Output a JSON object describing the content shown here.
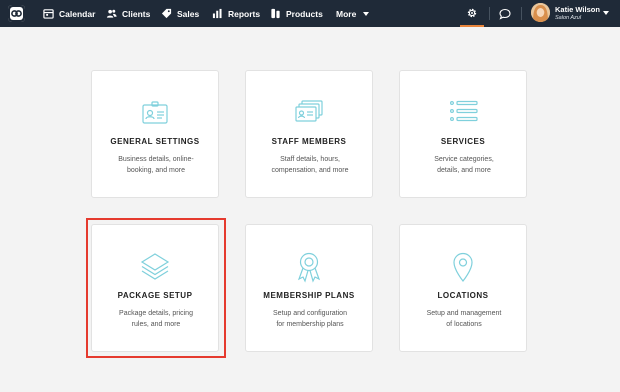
{
  "nav": {
    "items": [
      {
        "label": "Calendar",
        "icon": "calendar-icon"
      },
      {
        "label": "Clients",
        "icon": "clients-icon"
      },
      {
        "label": "Sales",
        "icon": "sales-tag-icon"
      },
      {
        "label": "Reports",
        "icon": "bar-chart-icon"
      },
      {
        "label": "Products",
        "icon": "product-box-icon"
      },
      {
        "label": "More",
        "icon": "chevron-down-icon"
      }
    ],
    "accent_color": "#e8843b",
    "bar_color": "#1f2a38"
  },
  "user": {
    "name": "Katie Wilson",
    "business": "Salon Azul"
  },
  "cards": [
    {
      "title": "GENERAL SETTINGS",
      "desc": [
        "Business details, online-",
        "booking, and more"
      ],
      "icon": "id-card-icon"
    },
    {
      "title": "STAFF MEMBERS",
      "desc": [
        "Staff details, hours,",
        "compensation, and more"
      ],
      "icon": "staff-cards-icon"
    },
    {
      "title": "SERVICES",
      "desc": [
        "Service categories,",
        "details, and more"
      ],
      "icon": "list-icon"
    },
    {
      "title": "PACKAGE SETUP",
      "desc": [
        "Package details, pricing",
        "rules, and more"
      ],
      "icon": "layers-icon"
    },
    {
      "title": "MEMBERSHIP PLANS",
      "desc": [
        "Setup and configuration",
        "for membership plans"
      ],
      "icon": "ribbon-badge-icon"
    },
    {
      "title": "LOCATIONS",
      "desc": [
        "Setup and management",
        "of locations"
      ],
      "icon": "map-pin-icon"
    }
  ],
  "icon_color": "#7fd0dc",
  "highlight_color": "#e53a2e"
}
